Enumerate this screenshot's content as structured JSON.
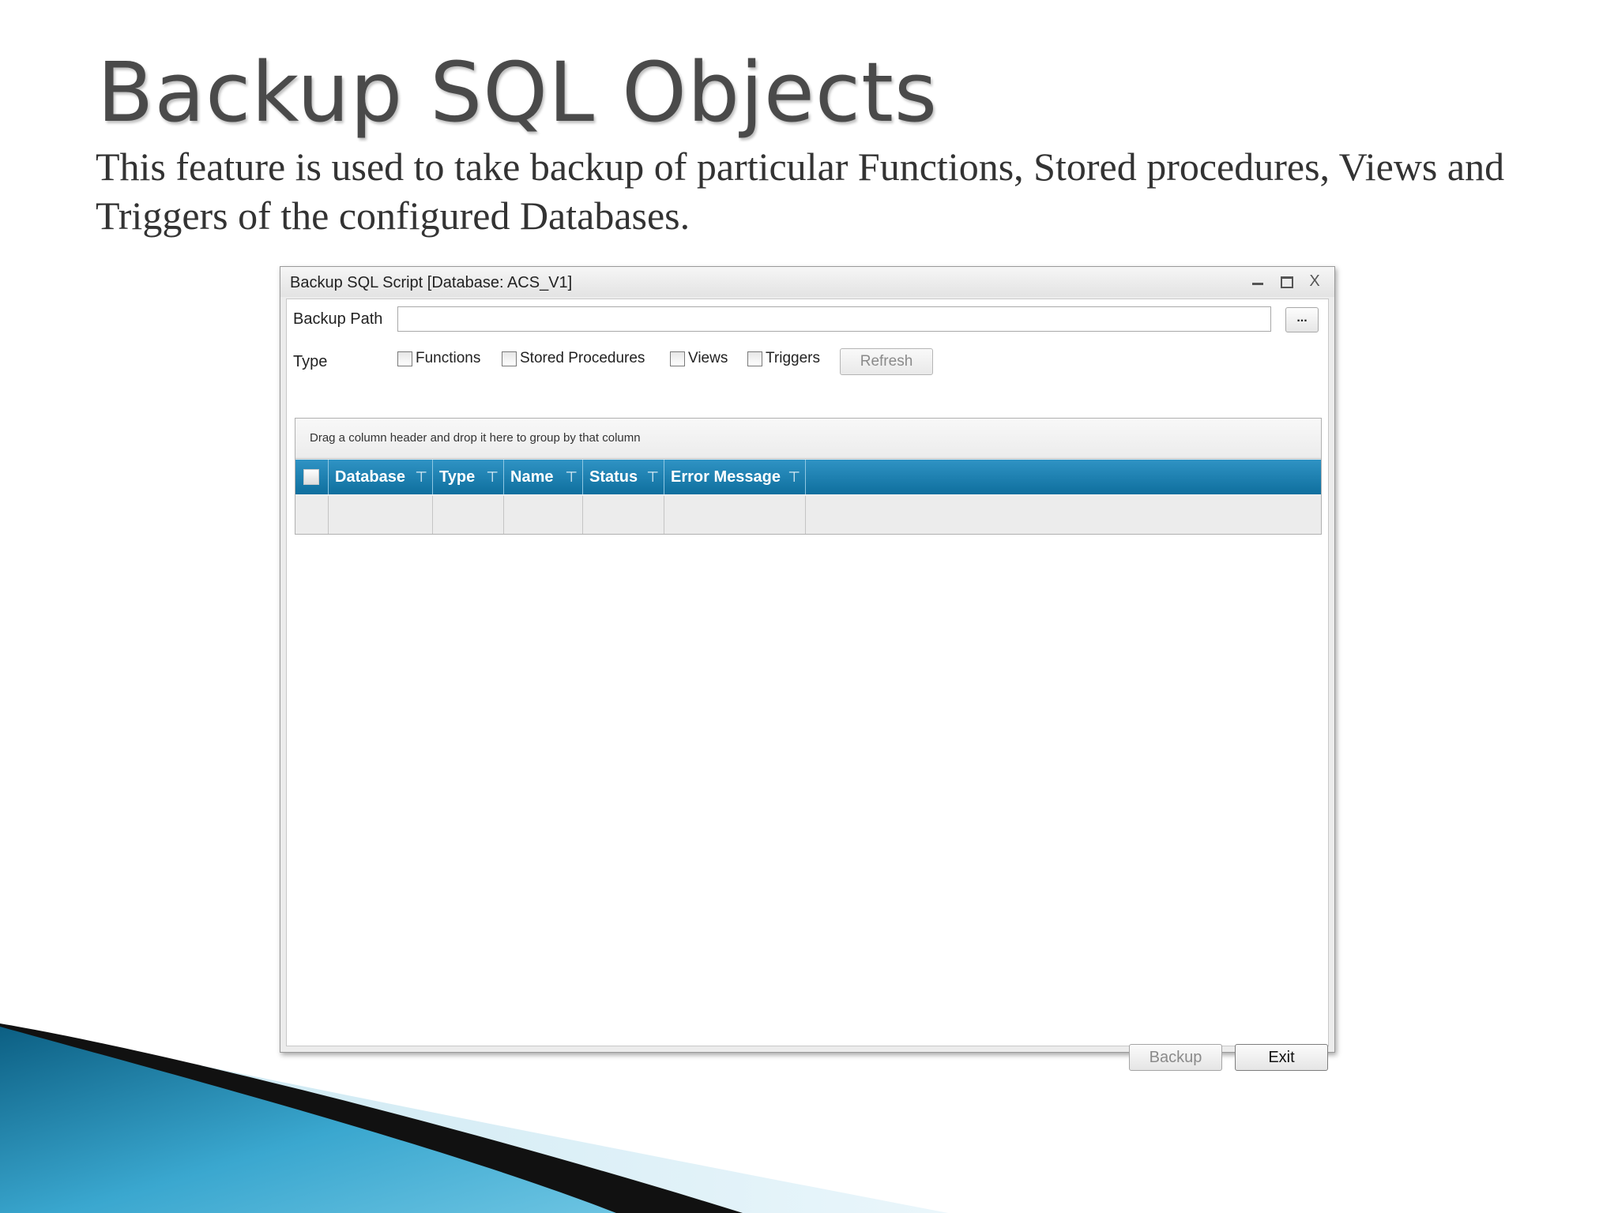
{
  "slide": {
    "title": "Backup SQL Objects",
    "description": "This feature is used to take backup of particular Functions, Stored procedures, Views and Triggers of the configured Databases."
  },
  "window": {
    "title": "Backup SQL Script [Database: ACS_V1]",
    "minimize_icon": "minimize-icon",
    "maximize_icon": "maximize-icon",
    "close_label": "X"
  },
  "form": {
    "backup_path_label": "Backup Path",
    "backup_path_value": "",
    "browse_label": "...",
    "type_label": "Type",
    "types": [
      {
        "label": "Functions",
        "checked": false
      },
      {
        "label": "Stored Procedures",
        "checked": false
      },
      {
        "label": "Views",
        "checked": false
      },
      {
        "label": "Triggers",
        "checked": false
      }
    ],
    "refresh_label": "Refresh"
  },
  "grid": {
    "group_panel_text": "Drag a column header and drop it here to group by that column",
    "columns": [
      "Database",
      "Type",
      "Name",
      "Status",
      "Error Message"
    ],
    "filter_icon": "filter-icon",
    "rows": []
  },
  "footer": {
    "backup_label": "Backup",
    "exit_label": "Exit"
  },
  "colors": {
    "header_blue": "#1a7fb0",
    "swoosh_blue": "#2a8fb8",
    "swoosh_dark": "#111111"
  }
}
